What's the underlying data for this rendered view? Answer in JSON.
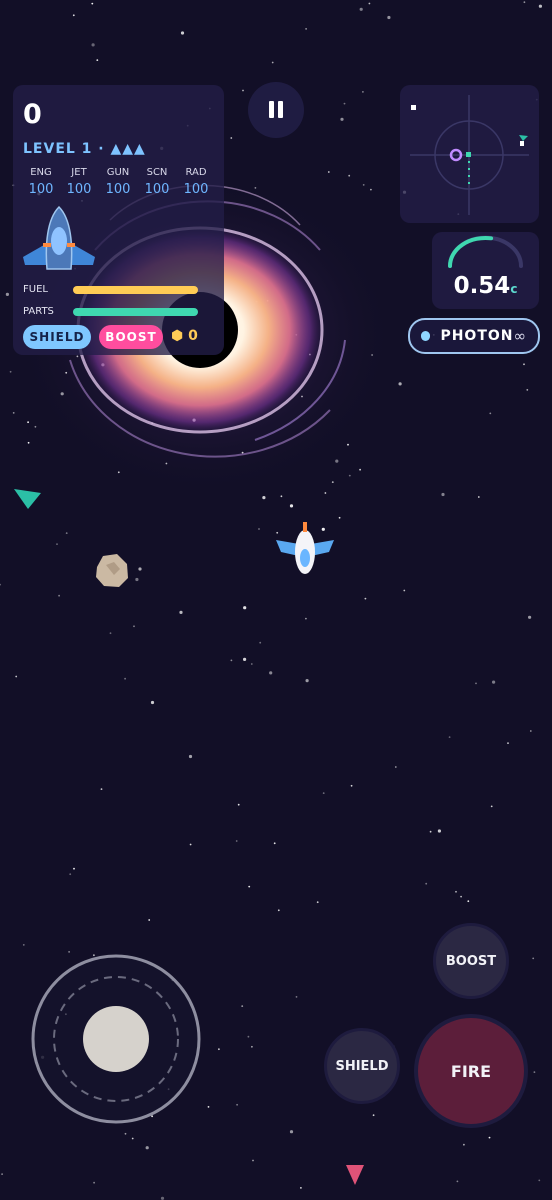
{
  "hud": {
    "score": "0",
    "level": "LEVEL 1 · ▲▲▲",
    "stats": [
      {
        "label": "ENG",
        "value": "100"
      },
      {
        "label": "JET",
        "value": "100"
      },
      {
        "label": "GUN",
        "value": "100"
      },
      {
        "label": "SCN",
        "value": "100"
      },
      {
        "label": "RAD",
        "value": "100"
      }
    ],
    "fuel_label": "FUEL",
    "fuel_level": 1.0,
    "parts_label": "PARTS",
    "parts_level": 1.0,
    "shield_label": "SHIELD",
    "boost_label": "BOOST",
    "coins": "0",
    "coin_icon": "hexagon-coin-icon"
  },
  "speed": {
    "value": "0.54",
    "unit": "c",
    "gauge_fraction": 0.55
  },
  "weapon": {
    "name": "PHOTON",
    "ammo": "∞"
  },
  "controls": {
    "boost": "BOOST",
    "shield": "SHIELD",
    "fire": "FIRE"
  },
  "colors": {
    "background": "#120f27",
    "fuel": "#ffcc55",
    "parts": "#3fd8b0",
    "shield": "#7fc7ff",
    "boost": "#ff4d9e",
    "fire": "#5c1e3a",
    "gauge": "#3fd8b0",
    "coin": "#ffcb57"
  }
}
